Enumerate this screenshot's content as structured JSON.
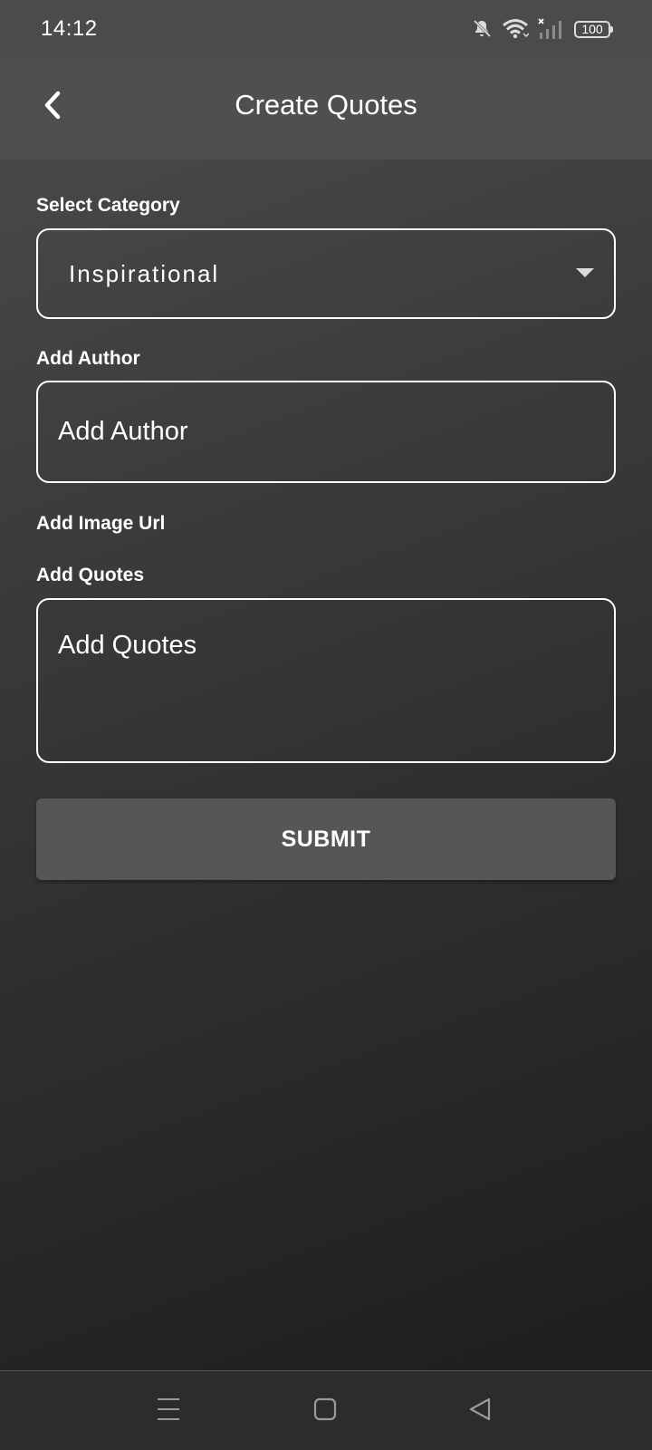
{
  "status_bar": {
    "time": "14:12",
    "icons": [
      "bell-muted-icon",
      "wifi-icon",
      "signal-icon"
    ],
    "battery": "100"
  },
  "app_bar": {
    "title": "Create Quotes",
    "back_icon": "chevron-left-icon"
  },
  "form": {
    "category": {
      "label": "Select Category",
      "value": "Inspirational"
    },
    "author": {
      "label": "Add Author",
      "placeholder": "Add Author",
      "value": ""
    },
    "image_url": {
      "label": "Add Image Url"
    },
    "quotes": {
      "label": "Add Quotes",
      "placeholder": "Add Quotes",
      "value": ""
    },
    "submit_label": "SUBMIT"
  },
  "nav_bar": {
    "icons": [
      "menu-icon",
      "home-square-icon",
      "back-triangle-icon"
    ]
  },
  "colors": {
    "background_top": "#4d4d4d",
    "background_bottom": "#1c1c1c",
    "app_bar": "#4f4f4f",
    "submit_button": "#565656",
    "field_border": "#ffffff"
  }
}
